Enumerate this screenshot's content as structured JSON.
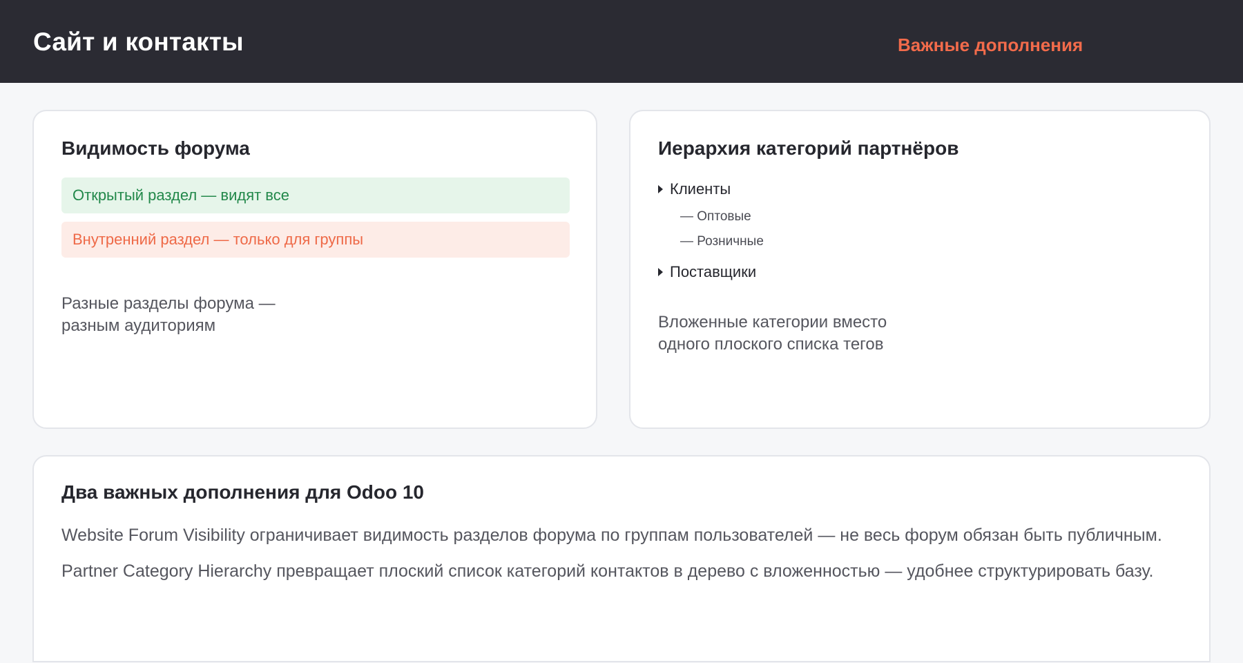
{
  "header": {
    "title": "Сайт и контакты",
    "link": "Важные дополнения"
  },
  "forum_card": {
    "title": "Видимость форума",
    "open_section": "Открытый раздел — видят все",
    "internal_section": "Внутренний раздел — только для группы",
    "note": "Разные разделы форума — разным аудиториям"
  },
  "hierarchy_card": {
    "title": "Иерархия категорий партнёров",
    "tree": [
      {
        "label": "Клиенты",
        "children": [
          "— Оптовые",
          "— Розничные"
        ]
      },
      {
        "label": "Поставщики",
        "children": []
      }
    ],
    "note": "Вложенные категории вместо одного плоского списка тегов"
  },
  "summary_card": {
    "title": "Два важных дополнения для Odoo 10",
    "paragraphs": [
      "Website Forum Visibility ограничивает видимость разделов форума по группам пользователей — не весь форум обязан быть публичным.",
      "Partner Category Hierarchy превращает плоский список категорий контактов в дерево с вложенностью — удобнее структурировать базу."
    ]
  },
  "colors": {
    "topbar": "#2b2b33",
    "accent": "#f26b4b",
    "open_text": "#22884a",
    "open_bg": "#e6f5ea",
    "internal_text": "#ee6947",
    "internal_bg": "#fdece7"
  }
}
